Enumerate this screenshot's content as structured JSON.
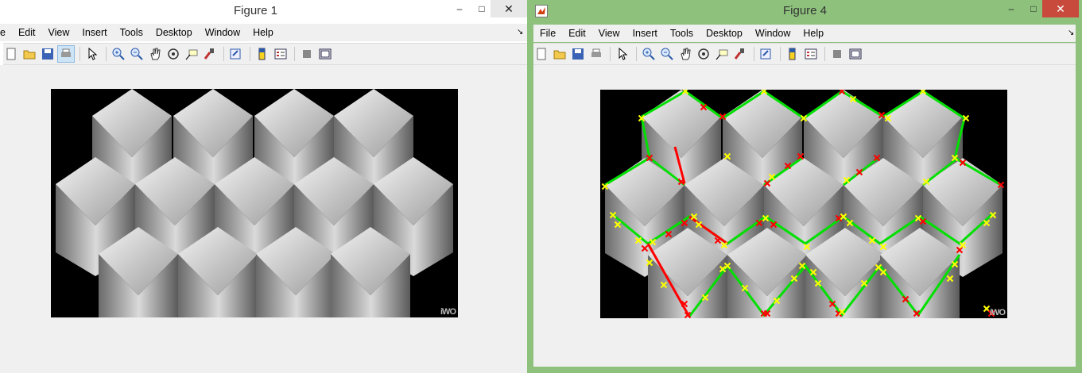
{
  "figure1": {
    "title": "Figure 1",
    "menu": [
      "e",
      "Edit",
      "View",
      "Insert",
      "Tools",
      "Desktop",
      "Window",
      "Help"
    ]
  },
  "figure4": {
    "title": "Figure 4",
    "menu": [
      "File",
      "Edit",
      "View",
      "Insert",
      "Tools",
      "Desktop",
      "Window",
      "Help"
    ]
  },
  "window_controls": {
    "minimize": "–",
    "maximize": "□",
    "close": "✕"
  },
  "dock_arrow": "↘",
  "watermark": "iWO",
  "colors": {
    "edge_green": "#00e000",
    "edge_red": "#ff0000",
    "marker_yellow": "#ffff00",
    "marker_red": "#ff0000",
    "window_frame": "#8dc17c"
  },
  "icons": [
    "new-figure-icon",
    "open-file-icon",
    "save-icon",
    "print-icon",
    "pointer-icon",
    "zoom-in-icon",
    "zoom-out-icon",
    "pan-icon",
    "rotate-3d-icon",
    "data-cursor-icon",
    "brush-icon",
    "link-plot-icon",
    "colorbar-icon",
    "legend-icon",
    "hide-plot-tools-icon",
    "show-plot-tools-icon"
  ]
}
